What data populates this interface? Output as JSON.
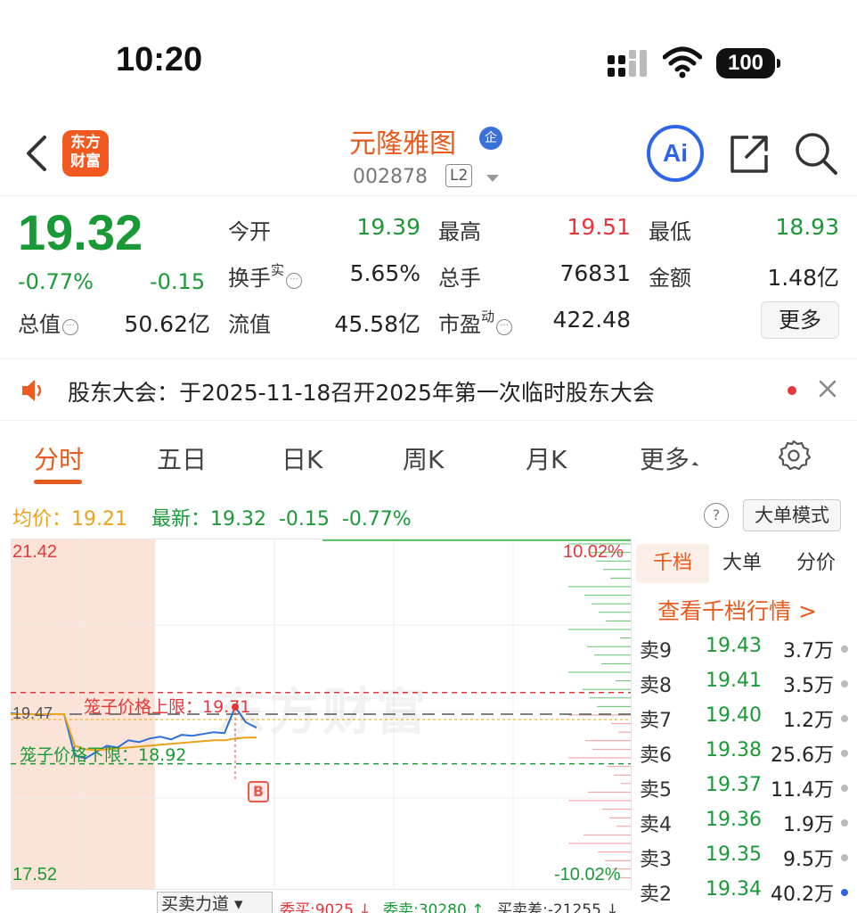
{
  "status_bar": {
    "time": "10:20",
    "battery": "100"
  },
  "header": {
    "brand_logo": "东方\n财富",
    "stock_name": "元隆雅图",
    "enterprise_badge": "企",
    "stock_code": "002878",
    "level_badge": "L2",
    "ai_label": "Ai"
  },
  "quote": {
    "price": "19.32",
    "change_pct": "-0.77%",
    "change_abs": "-0.15",
    "open_label": "今开",
    "open_value": "19.39",
    "high_label": "最高",
    "high_value": "19.51",
    "low_label": "最低",
    "low_value": "18.93",
    "turnover_label": "换手",
    "turnover_sup": "实",
    "turnover_value": "5.65%",
    "volume_label": "总手",
    "volume_value": "76831",
    "amount_label": "金额",
    "amount_value": "1.48亿",
    "mktcap_label": "总值",
    "mktcap_value": "50.62亿",
    "float_label": "流值",
    "float_value": "45.58亿",
    "pe_label": "市盈",
    "pe_sup": "动",
    "pe_value": "422.48",
    "more_label": "更多"
  },
  "notice": {
    "text": "股东大会：于2025-11-18召开2025年第一次临时股东大会"
  },
  "tabs": [
    {
      "label": "分时"
    },
    {
      "label": "五日"
    },
    {
      "label": "日K"
    },
    {
      "label": "周K"
    },
    {
      "label": "月K"
    },
    {
      "label": "更多"
    }
  ],
  "chart_info": {
    "avg": "均价：19.21",
    "latest": "最新：19.32  -0.15  -0.77%",
    "help": "?",
    "bigorder_mode": "大单模式"
  },
  "chart_data": {
    "type": "line",
    "ylim": [
      17.52,
      21.42
    ],
    "y_top_label": "21.42",
    "y_bottom_label": "17.52",
    "pct_top_label": "10.02%",
    "pct_bottom_label": "-10.02%",
    "prev_close_label": "19.47",
    "prev_close": 19.47,
    "upper_limit_label": "笼子价格上限：19.71",
    "upper_limit": 19.71,
    "lower_limit_label": "笼子价格下限：18.92",
    "lower_limit": 18.92,
    "trade_marker": "B",
    "watermark": "东方财富",
    "series": [
      {
        "name": "价格",
        "values": [
          19.48,
          19.47,
          19.47,
          19.46,
          19.47,
          19.47,
          19.01,
          18.98,
          19.05,
          19.12,
          19.1,
          19.18,
          19.16,
          19.2,
          19.22,
          19.19,
          19.24,
          19.23,
          19.25,
          19.27,
          19.26,
          19.55,
          19.38,
          19.32
        ]
      },
      {
        "name": "均价",
        "values": [
          19.47,
          19.47,
          19.47,
          19.47,
          19.47,
          19.47,
          19.12,
          19.08,
          19.07,
          19.08,
          19.09,
          19.1,
          19.11,
          19.12,
          19.13,
          19.14,
          19.15,
          19.16,
          19.17,
          19.18,
          19.18,
          19.2,
          19.21,
          19.21
        ]
      }
    ]
  },
  "orderbook": {
    "tabs": [
      "千档",
      "大单",
      "分价"
    ],
    "link": "查看千档行情 >",
    "rows": [
      {
        "side": "卖9",
        "price": "19.43",
        "vol": "3.7万"
      },
      {
        "side": "卖8",
        "price": "19.41",
        "vol": "3.5万"
      },
      {
        "side": "卖7",
        "price": "19.40",
        "vol": "1.2万"
      },
      {
        "side": "卖6",
        "price": "19.38",
        "vol": "25.6万"
      },
      {
        "side": "卖5",
        "price": "19.37",
        "vol": "11.4万"
      },
      {
        "side": "卖4",
        "price": "19.36",
        "vol": "1.9万"
      },
      {
        "side": "卖3",
        "price": "19.35",
        "vol": "9.5万"
      },
      {
        "side": "卖2",
        "price": "19.34",
        "vol": "40.2万"
      }
    ]
  },
  "bottom": {
    "force_select": "买卖力道 ▾",
    "wei_buy": "委买:9025 ↓",
    "wei_sell": "委卖:30280 ↑",
    "wei_diff": "买卖差:-21255 ↓"
  },
  "colors": {
    "up": "#e8353a",
    "down": "#1a9a36",
    "accent": "#e85a1c",
    "avg": "#e8a21c",
    "price_line": "#2e6fd9"
  }
}
